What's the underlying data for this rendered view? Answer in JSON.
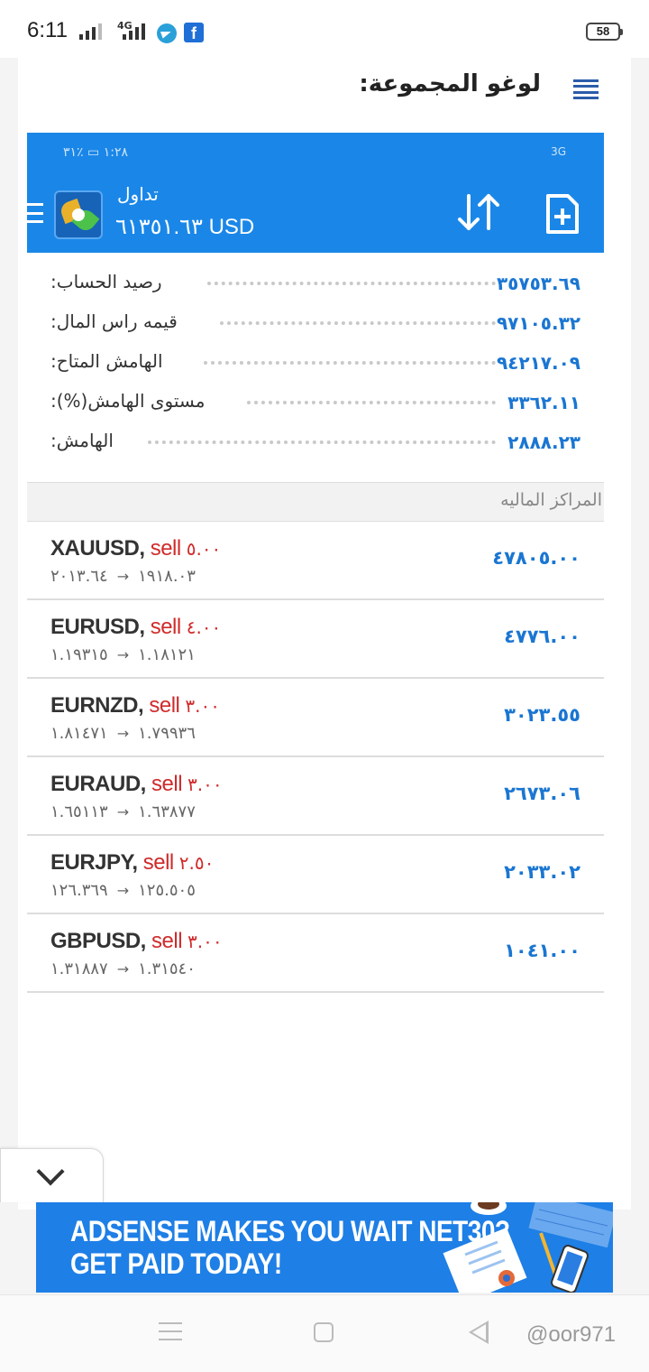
{
  "status_bar": {
    "time": "6:11",
    "network": "4G",
    "battery": "58"
  },
  "page": {
    "title": "لوغو المجموعة:"
  },
  "app": {
    "inner_status_left": "١:٢٨ ▭ ٪٣١",
    "inner_status_right": "3G",
    "account_title": "تداول",
    "account_balance": "٦١٣٥١.٦٣ USD"
  },
  "summary": [
    {
      "label": "رصيد الحساب:",
      "value": "٣٥٧٥٣.٦٩"
    },
    {
      "label": "قيمه راس المال:",
      "value": "٩٧١٠٥.٣٢"
    },
    {
      "label": "الهامش المتاح:",
      "value": "٩٤٢١٧.٠٩"
    },
    {
      "label": "مستوى الهامش(%):",
      "value": "٣٣٦٢.١١"
    },
    {
      "label": "الهامش:",
      "value": "٢٨٨٨.٢٣"
    }
  ],
  "positions_header": "المراكز الماليه",
  "positions": [
    {
      "symbol": "XAUUSD,",
      "type": "sell",
      "volume": "٥.٠٠",
      "open": "١٩١٨.٠٣",
      "current": "٢٠١٣.٦٤",
      "profit": "٤٧٨٠٥.٠٠"
    },
    {
      "symbol": "EURUSD,",
      "type": "sell",
      "volume": "٤.٠٠",
      "open": "١.١٨١٢١",
      "current": "١.١٩٣١٥",
      "profit": "٤٧٧٦.٠٠"
    },
    {
      "symbol": "EURNZD,",
      "type": "sell",
      "volume": "٣.٠٠",
      "open": "١.٧٩٩٣٦",
      "current": "١.٨١٤٧١",
      "profit": "٣٠٢٣.٥٥"
    },
    {
      "symbol": "EURAUD,",
      "type": "sell",
      "volume": "٣.٠٠",
      "open": "١.٦٣٨٧٧",
      "current": "١.٦٥١١٣",
      "profit": "٢٦٧٣.٠٦"
    },
    {
      "symbol": "EURJPY,",
      "type": "sell",
      "volume": "٢.٥٠",
      "open": "١٢٥.٥٠٥",
      "current": "١٢٦.٣٦٩",
      "profit": "٢٠٣٣.٠٢"
    },
    {
      "symbol": "GBPUSD,",
      "type": "sell",
      "volume": "٣.٠٠",
      "open": "١.٣١٥٤٠",
      "current": "١.٣١٨٨٧",
      "profit": "١٠٤١.٠٠"
    }
  ],
  "ad": {
    "line1": "ADSENSE MAKES YOU WAIT NET30?",
    "line2": "GET PAID TODAY!"
  },
  "watermark": "@oor971",
  "colors": {
    "app_blue": "#1a87e8",
    "profit_blue": "#1a76d2",
    "sell_red": "#d02b2b",
    "menu_blue": "#2a5caa"
  },
  "icons": {
    "menu": "hamburger-icon",
    "sort": "sort-arrows-icon",
    "new_order": "add-document-icon",
    "collapse": "chevron-down-icon"
  }
}
